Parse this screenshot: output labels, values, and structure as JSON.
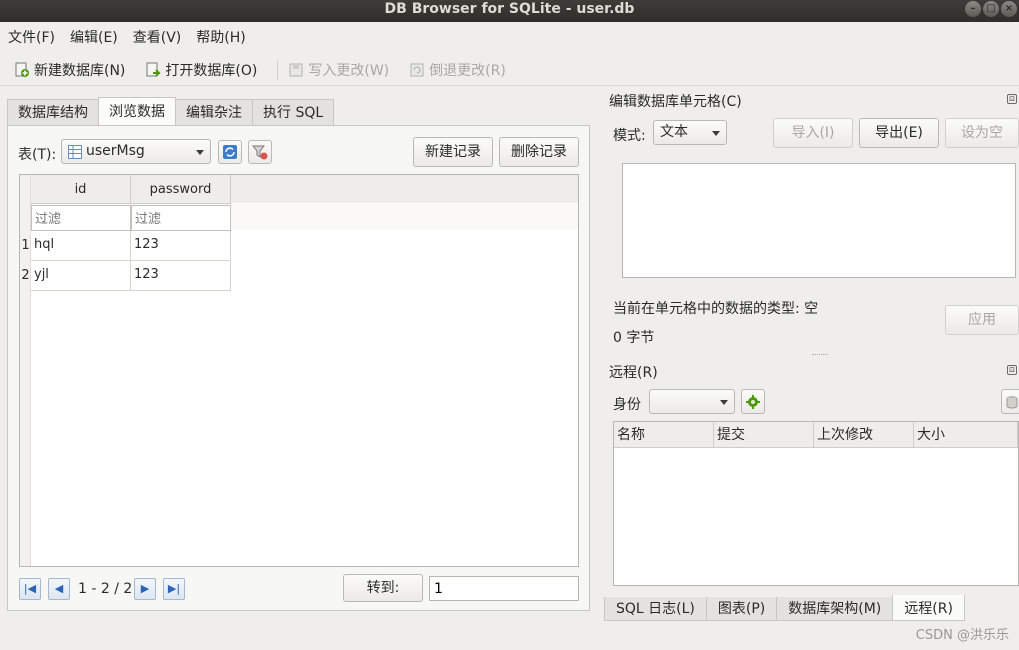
{
  "window": {
    "title": "DB Browser for SQLite - user.db"
  },
  "menu": [
    "文件(F)",
    "编辑(E)",
    "查看(V)",
    "帮助(H)"
  ],
  "toolbar": {
    "new_db": "新建数据库(N)",
    "open_db": "打开数据库(O)",
    "write_changes": "写入更改(W)",
    "revert_changes": "倒退更改(R)"
  },
  "main_tabs": [
    "数据库结构",
    "浏览数据",
    "编辑杂注",
    "执行 SQL"
  ],
  "browse": {
    "table_label": "表(T):",
    "table_selected": "userMsg",
    "new_record": "新建记录",
    "delete_record": "删除记录",
    "columns": [
      "id",
      "password"
    ],
    "filter_placeholder": "过滤",
    "rows": [
      {
        "num": "1",
        "id": "hql",
        "password": "123"
      },
      {
        "num": "2",
        "id": "yjl",
        "password": "123"
      }
    ],
    "page_info": "1 - 2 / 2",
    "goto_label": "转到:",
    "goto_value": "1"
  },
  "edit_cell": {
    "title": "编辑数据库单元格(C)",
    "mode_label": "模式:",
    "mode_value": "文本",
    "import": "导入(I)",
    "export": "导出(E)",
    "set_null": "设为空",
    "type_info": "当前在单元格中的数据的类型: 空",
    "size_info": "0 字节",
    "apply": "应用"
  },
  "remote": {
    "title": "远程(R)",
    "identity_label": "身份",
    "columns": [
      "名称",
      "提交",
      "上次修改",
      "大小"
    ]
  },
  "bottom_tabs": [
    "SQL 日志(L)",
    "图表(P)",
    "数据库架构(M)",
    "远程(R)"
  ],
  "watermark": "CSDN @洪乐乐"
}
